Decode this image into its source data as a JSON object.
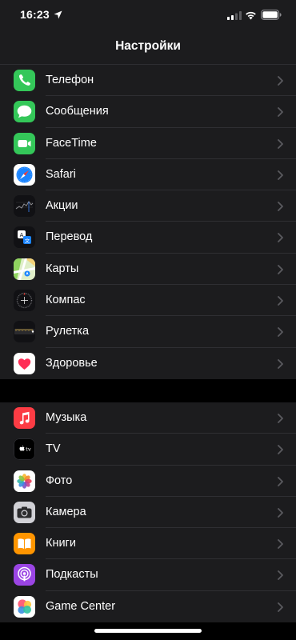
{
  "status_bar": {
    "time": "16:23",
    "icons": [
      "location-arrow-icon",
      "cellular-signal-icon",
      "wifi-icon",
      "battery-icon"
    ]
  },
  "nav": {
    "title": "Настройки"
  },
  "groups": [
    {
      "items": [
        {
          "label": "Телефон",
          "icon": "phone-icon",
          "color": "#34c759"
        },
        {
          "label": "Сообщения",
          "icon": "messages-icon",
          "color": "#34c759"
        },
        {
          "label": "FaceTime",
          "icon": "facetime-icon",
          "color": "#34c759"
        },
        {
          "label": "Safari",
          "icon": "safari-icon",
          "color": "#1a84ff"
        },
        {
          "label": "Акции",
          "icon": "stocks-icon",
          "color": "#1c1c1e"
        },
        {
          "label": "Перевод",
          "icon": "translate-icon",
          "color": "#1c1c1e"
        },
        {
          "label": "Карты",
          "icon": "maps-icon",
          "color": "#6fcf6f"
        },
        {
          "label": "Компас",
          "icon": "compass-icon",
          "color": "#1c1c1e"
        },
        {
          "label": "Рулетка",
          "icon": "measure-icon",
          "color": "#1c1c1e"
        },
        {
          "label": "Здоровье",
          "icon": "health-icon",
          "color": "#ff2d55"
        }
      ]
    },
    {
      "items": [
        {
          "label": "Музыка",
          "icon": "music-icon",
          "color": "#fc3c44"
        },
        {
          "label": "TV",
          "icon": "tv-icon",
          "color": "#000000"
        },
        {
          "label": "Фото",
          "icon": "photos-icon",
          "color": "#ffffff"
        },
        {
          "label": "Камера",
          "icon": "camera-icon",
          "color": "#8e8e93"
        },
        {
          "label": "Книги",
          "icon": "books-icon",
          "color": "#ff9500"
        },
        {
          "label": "Подкасты",
          "icon": "podcasts-icon",
          "color": "#9b45e4"
        },
        {
          "label": "Game Center",
          "icon": "game-center-icon",
          "color": "#ffffff"
        }
      ]
    }
  ],
  "colors": {
    "background": "#000000",
    "cell": "#1c1c1e",
    "separator": "#2f2f33",
    "chevron": "#5a5a5f",
    "text": "#ffffff"
  }
}
